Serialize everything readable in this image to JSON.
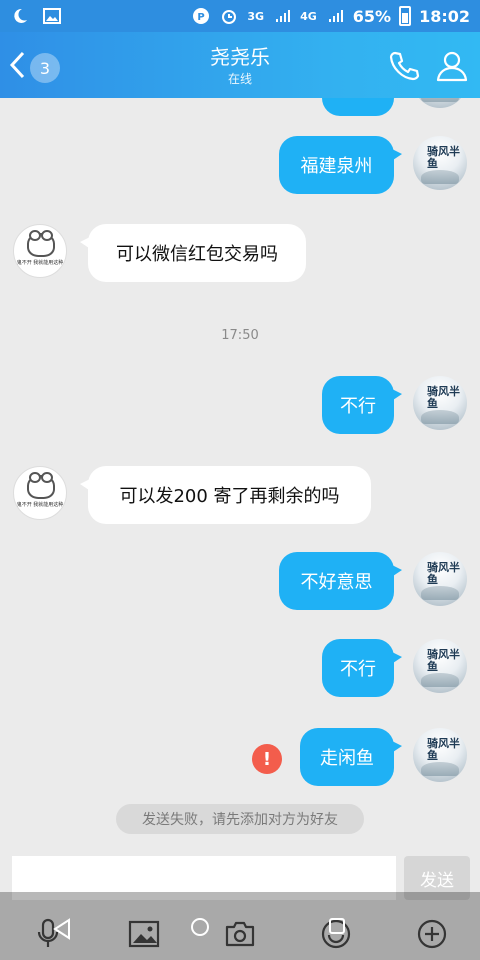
{
  "status_bar": {
    "moon_icon": "moon-icon",
    "image_icon": "image-icon",
    "net1": "3G",
    "net2": "4G",
    "battery": "65%",
    "time": "18:02"
  },
  "header": {
    "unread_count": "3",
    "contact_name": "尧尧乐",
    "contact_status": "在线"
  },
  "messages": [
    {
      "side": "right",
      "text": "福建泉州"
    },
    {
      "side": "left",
      "text": "可以微信红包交易吗"
    },
    {
      "side": "time",
      "text": "17:50"
    },
    {
      "side": "right",
      "text": "不行"
    },
    {
      "side": "left",
      "text": "可以发200 寄了再剩余的吗"
    },
    {
      "side": "right",
      "text": "不好意思"
    },
    {
      "side": "right",
      "text": "不行"
    },
    {
      "side": "right",
      "text": "走闲鱼",
      "failed": true
    }
  ],
  "failed_icon_text": "!",
  "system_notice": "发送失败，请先添加对方为好友",
  "input": {
    "value": "",
    "send_label": "发送"
  },
  "avatar_right_glyphs": "骑风半鱼",
  "avatar_left_caption": "鬼不开 我就能用这种",
  "colors": {
    "header_start": "#2f8fe6",
    "header_end": "#32b9f3",
    "bubble_right": "#1fb1f5",
    "bubble_left": "#ffffff",
    "error": "#f35d4c"
  }
}
